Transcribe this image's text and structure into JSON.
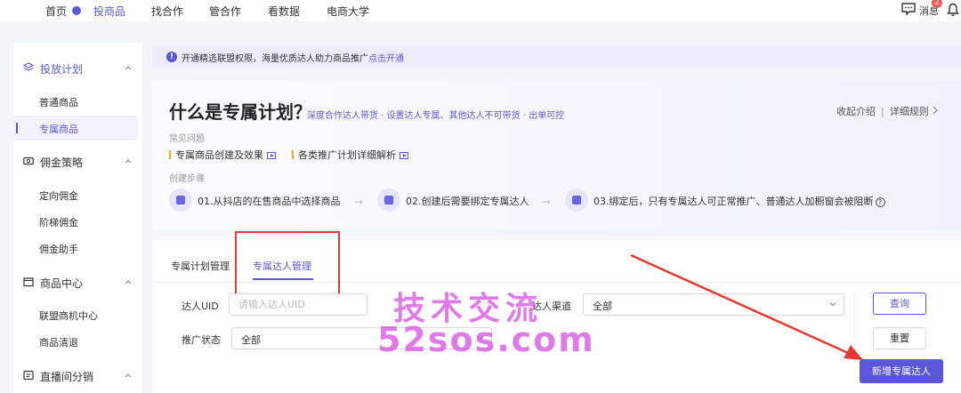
{
  "topnav": {
    "items": [
      {
        "label": "首页",
        "active": false
      },
      {
        "label": "投商品",
        "active": true
      },
      {
        "label": "找合作",
        "active": false
      },
      {
        "label": "管合作",
        "active": false
      },
      {
        "label": "看数据",
        "active": false
      },
      {
        "label": "电商大学",
        "active": false
      }
    ],
    "message_label": "消息",
    "message_badge": "2",
    "icons": [
      "message-icon",
      "bell-icon"
    ]
  },
  "sidebar": {
    "groups": [
      {
        "label": "投放计划",
        "icon": "layers-icon",
        "active": true,
        "items": [
          {
            "label": "普通商品",
            "active": false
          },
          {
            "label": "专属商品",
            "active": true
          }
        ]
      },
      {
        "label": "佣金策略",
        "icon": "coupon-icon",
        "active": false,
        "items": [
          {
            "label": "定向佣金",
            "active": false
          },
          {
            "label": "阶梯佣金",
            "active": false
          },
          {
            "label": "佣金助手",
            "active": false
          }
        ]
      },
      {
        "label": "商品中心",
        "icon": "shop-icon",
        "active": false,
        "items": [
          {
            "label": "联盟商机中心",
            "active": false
          },
          {
            "label": "商品清退",
            "active": false
          }
        ]
      },
      {
        "label": "直播间分销",
        "icon": "live-icon",
        "active": false,
        "items": []
      }
    ]
  },
  "notice": {
    "text": "开通精选联盟权限，海量优质达人助力商品推广",
    "link": "点击开通"
  },
  "plan_intro": {
    "title": "什么是专属计划？",
    "subtitle": "深度合作达人带货 · 设置达人专属、其他达人不可带货 · 出单可控",
    "collapse_label": "收起介绍",
    "rules_label": "详细规则",
    "faq_label": "常见问题",
    "faq": [
      {
        "label": "专属商品创建及效果"
      },
      {
        "label": "各类推广计划详细解析"
      }
    ],
    "steps_label": "创建步骤",
    "steps": [
      {
        "label": "01.从抖店的在售商品中选择商品"
      },
      {
        "label": "02.创建后需要绑定专属达人"
      },
      {
        "label": "03.绑定后，只有专属达人可正常推广、普通达人加橱窗会被阻断"
      }
    ],
    "arrow": "→",
    "help": "?"
  },
  "tabs": [
    {
      "label": "专属计划管理",
      "active": false
    },
    {
      "label": "专属达人管理",
      "active": true
    }
  ],
  "filters": {
    "uid_label": "达人UID",
    "uid_placeholder": "请输入达人UID",
    "uid_value": "",
    "channel_label": "达人渠道",
    "channel_value": "全部",
    "status_label": "推广状态",
    "status_value": "全部"
  },
  "buttons": {
    "query": "查询",
    "reset": "重置",
    "add": "新增专属达人"
  },
  "watermark": {
    "line1": "技术交流",
    "line2": "52sos.com"
  },
  "colors": {
    "accent": "#5b57d8",
    "annotation": "#e53935",
    "watermark": "#d647e0"
  }
}
